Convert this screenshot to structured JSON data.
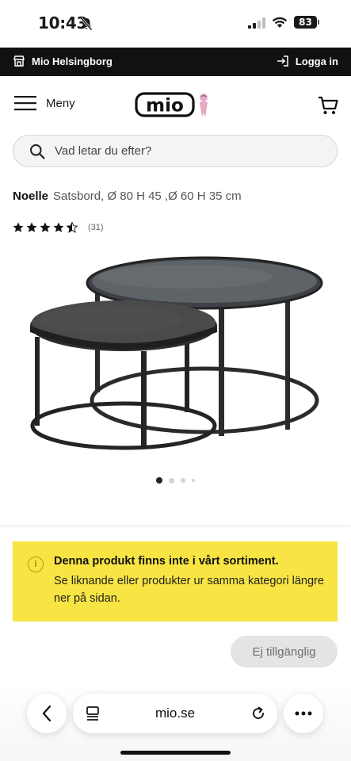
{
  "status_bar": {
    "time": "10:43",
    "battery": "83",
    "icons": [
      "bell-off-icon",
      "signal-icon",
      "wifi-icon",
      "battery-icon"
    ]
  },
  "store_bar": {
    "store_name": "Mio Helsingborg",
    "login_label": "Logga in",
    "store_icon": "store-icon",
    "login_icon": "login-icon"
  },
  "header": {
    "menu_label": "Meny",
    "logo_text": "mio",
    "cart_icon": "cart-icon"
  },
  "search": {
    "placeholder": "Vad letar du efter?"
  },
  "product": {
    "brand": "Noelle",
    "description": "Satsbord, Ø 80 H 45 ,Ø 60 H 35 cm",
    "rating": 4.5,
    "rating_count": "(31)",
    "image_pages": 4,
    "active_page": 1
  },
  "notice": {
    "title": "Denna produkt finns inte i vårt sortiment.",
    "text": "Se liknande eller produkter ur samma kategori längre ner på sidan.",
    "icon": "info-icon",
    "background": "#f8e443"
  },
  "actions": {
    "unavailable_label": "Ej tillgänglig"
  },
  "browser": {
    "url": "mio.se"
  },
  "colors": {
    "store_bar": "#111111",
    "notice": "#f8e443",
    "disabled_button": "#e4e4e4"
  }
}
